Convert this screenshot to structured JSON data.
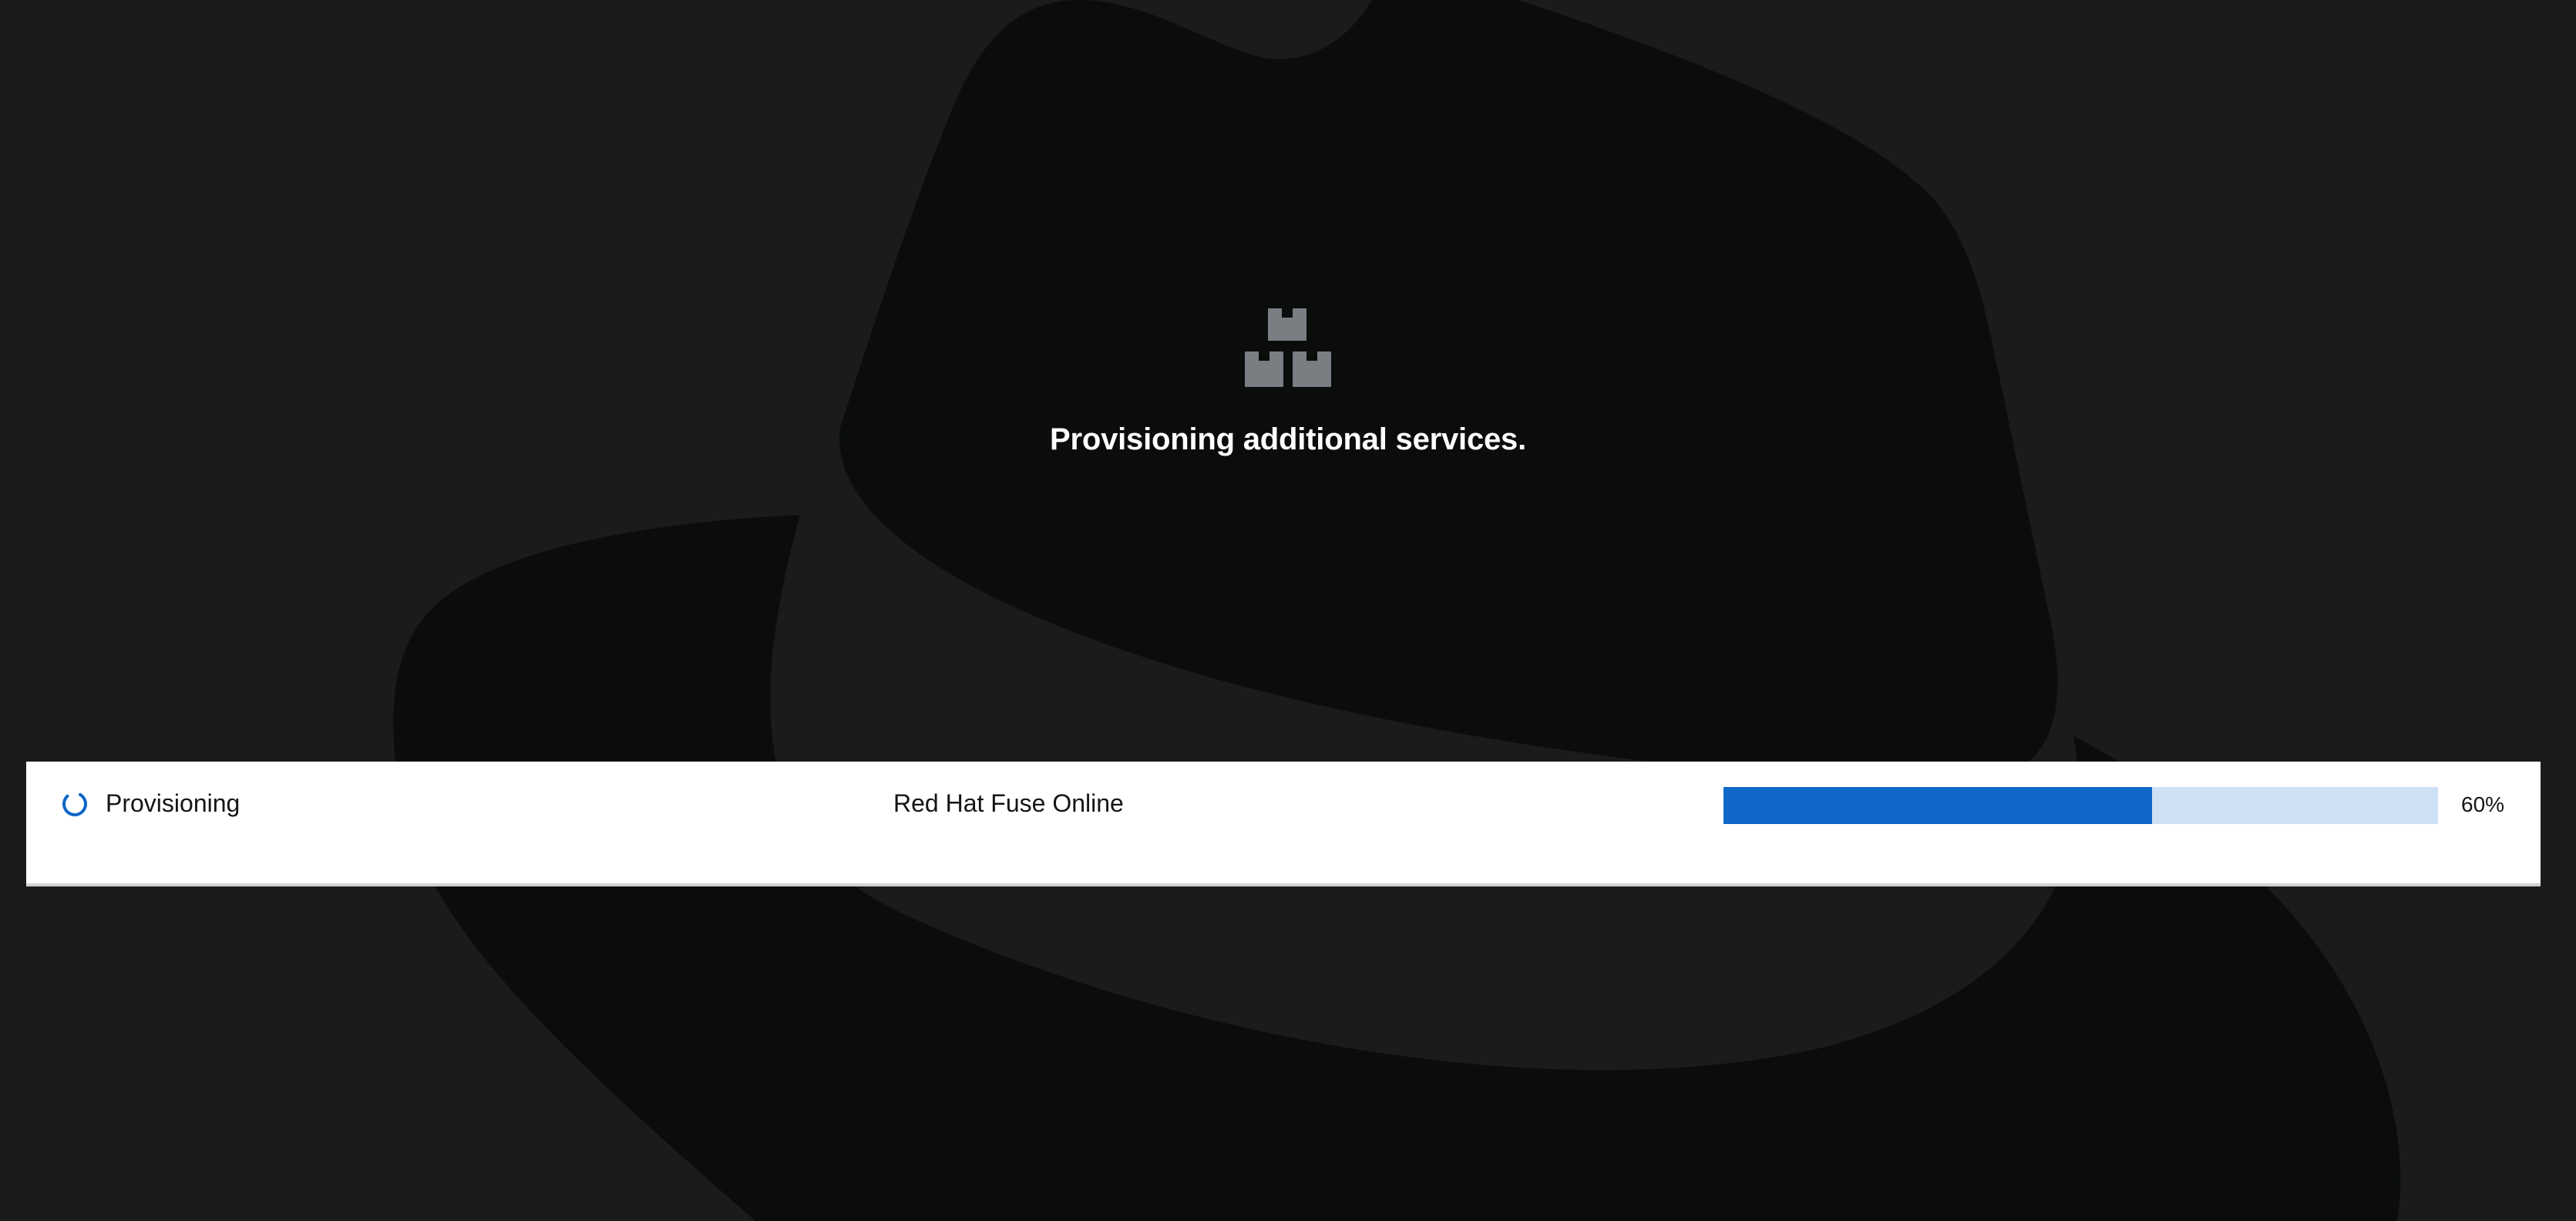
{
  "page": {
    "title": "Provisioning additional services."
  },
  "icons": {
    "hero": "boxes-icon",
    "status": "spinner-icon",
    "background": "red-hat-fedora-silhouette"
  },
  "services": [
    {
      "status": "Provisioning",
      "name": "Red Hat Fuse Online",
      "progress_percent": 60,
      "progress_label": "60%"
    }
  ],
  "colors": {
    "background": "#1b1b1b",
    "hat": "#0b0d0d",
    "progress_fill": "#0f67c7",
    "progress_track": "#cde0f4",
    "icon": "#7a7d81",
    "spinner": "#0f67c7"
  }
}
